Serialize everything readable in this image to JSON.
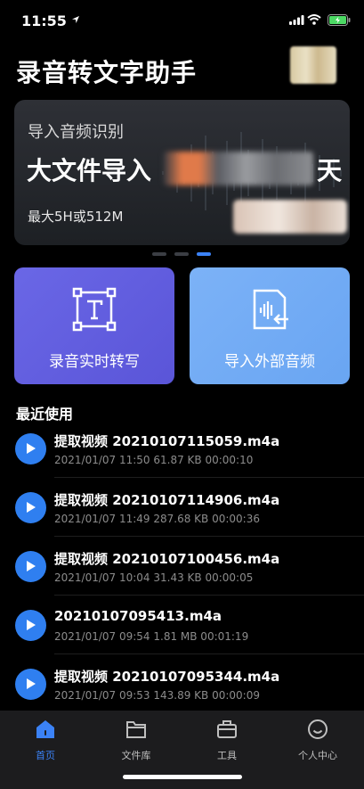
{
  "status": {
    "time": "11:55"
  },
  "header": {
    "title": "录音转文字助手"
  },
  "banner": {
    "subtitle": "导入音频识别",
    "main_prefix": "大文件导入",
    "main_suffix": "天",
    "limit": "最大5H或512M",
    "page_count": 3,
    "active_page": 3
  },
  "actions": {
    "record_label": "录音实时转写",
    "import_label": "导入外部音频"
  },
  "recent": {
    "title": "最近使用",
    "items": [
      {
        "name": "提取视频 20210107115059.m4a",
        "meta": "2021/01/07 11:50  61.87 KB  00:00:10"
      },
      {
        "name": "提取视频 20210107114906.m4a",
        "meta": "2021/01/07 11:49  287.68 KB  00:00:36"
      },
      {
        "name": "提取视频 20210107100456.m4a",
        "meta": "2021/01/07 10:04  31.43 KB  00:00:05"
      },
      {
        "name": "20210107095413.m4a",
        "meta": "2021/01/07 09:54  1.81 MB  00:01:19"
      },
      {
        "name": "提取视频 20210107095344.m4a",
        "meta": "2021/01/07 09:53  143.89 KB  00:00:09"
      }
    ]
  },
  "tabbar": {
    "home": "首页",
    "library": "文件库",
    "tools": "工具",
    "profile": "个人中心"
  },
  "colors": {
    "accent": "#3b82f6",
    "record_card": "#6460e2",
    "import_card": "#72abf4",
    "play_button": "#2f7ff0"
  }
}
